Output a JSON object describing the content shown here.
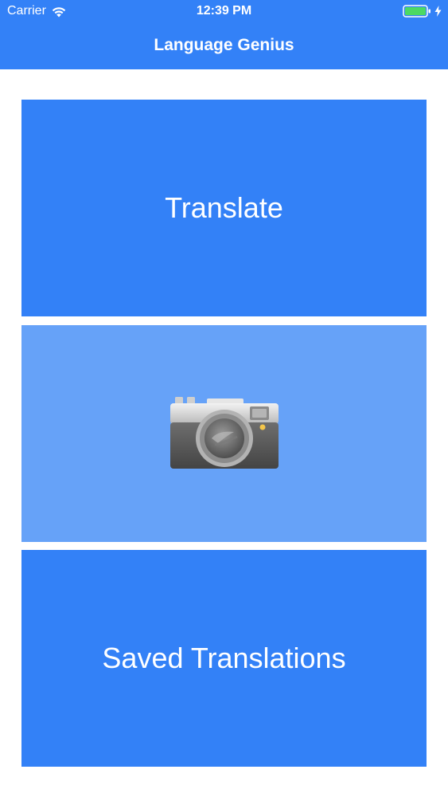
{
  "status_bar": {
    "carrier": "Carrier",
    "time": "12:39 PM",
    "wifi_icon": "wifi-icon",
    "battery_icon": "battery-icon",
    "charging_icon": "bolt-icon",
    "battery_color": "#4cd964"
  },
  "nav": {
    "title": "Language Genius"
  },
  "tiles": [
    {
      "label": "Translate",
      "color": "#3381f7"
    },
    {
      "icon": "camera-icon",
      "color": "#66a2f8"
    },
    {
      "label": "Saved Translations",
      "color": "#3381f7"
    }
  ],
  "colors": {
    "accent": "#3381f7",
    "accent_light": "#66a2f8",
    "background": "#ffffff"
  }
}
